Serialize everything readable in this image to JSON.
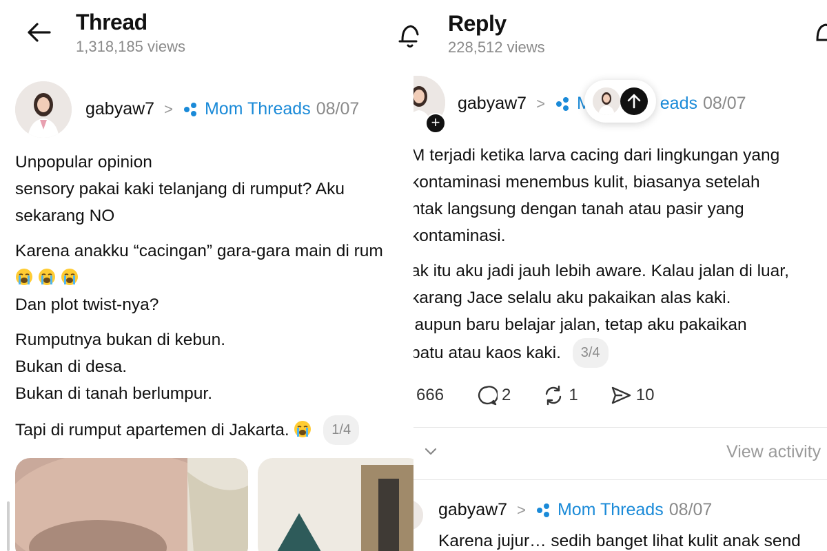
{
  "left": {
    "header": {
      "title": "Thread",
      "views": "1,318,185 views"
    },
    "post": {
      "username": "gabyaw7",
      "community": "Mom Threads",
      "date": "08/07",
      "lines": {
        "l1": "Unpopular opinion",
        "l2": "sensory pakai kaki telanjang di rumput? Aku",
        "l3": "sekarang NO",
        "l4": "Karena anakku “cacingan” gara-gara main di rum",
        "l5": "Dan plot twist-nya?",
        "l6": "Rumputnya bukan di kebun.",
        "l7": "Bukan di desa.",
        "l8": "Bukan di tanah berlumpur.",
        "l9": "Tapi di rumput apartemen di Jakarta."
      },
      "page_indicator": "1/4"
    },
    "icons": {
      "back": "back-arrow-icon",
      "emoji": "loudly-crying-face-emoji"
    }
  },
  "right": {
    "header": {
      "title": "Reply",
      "views": "228,512 views"
    },
    "post": {
      "username": "gabyaw7",
      "community_partial_a": "M",
      "community_partial_b": "eads",
      "date": "08/07",
      "lines": {
        "l1": "M terjadi ketika larva cacing dari lingkungan yang",
        "l2": "kontaminasi menembus kulit, biasanya setelah",
        "l3": "ntak langsung dengan tanah atau pasir yang",
        "l4": "kontaminasi.",
        "l5": "ak itu aku jadi jauh lebih aware. Kalau jalan di luar,",
        "l6": "karang Jace selalu aku pakaikan alas kaki.",
        "l7": "laupun baru belajar jalan, tetap aku pakaikan",
        "l8": "patu atau kaos kaki."
      },
      "page_indicator": "3/4",
      "actions": {
        "likes": "666",
        "comments": "2",
        "reposts": "1",
        "shares": "10"
      }
    },
    "activity": {
      "view_activity": "View activity"
    },
    "next_post": {
      "username": "gabyaw7",
      "community": "Mom Threads",
      "date": "08/07",
      "text": "Karena jujur… sedih banget lihat kulit anak send"
    }
  },
  "colors": {
    "accent": "#1a8ad8",
    "muted": "#8a8a8a",
    "text": "#111111"
  }
}
